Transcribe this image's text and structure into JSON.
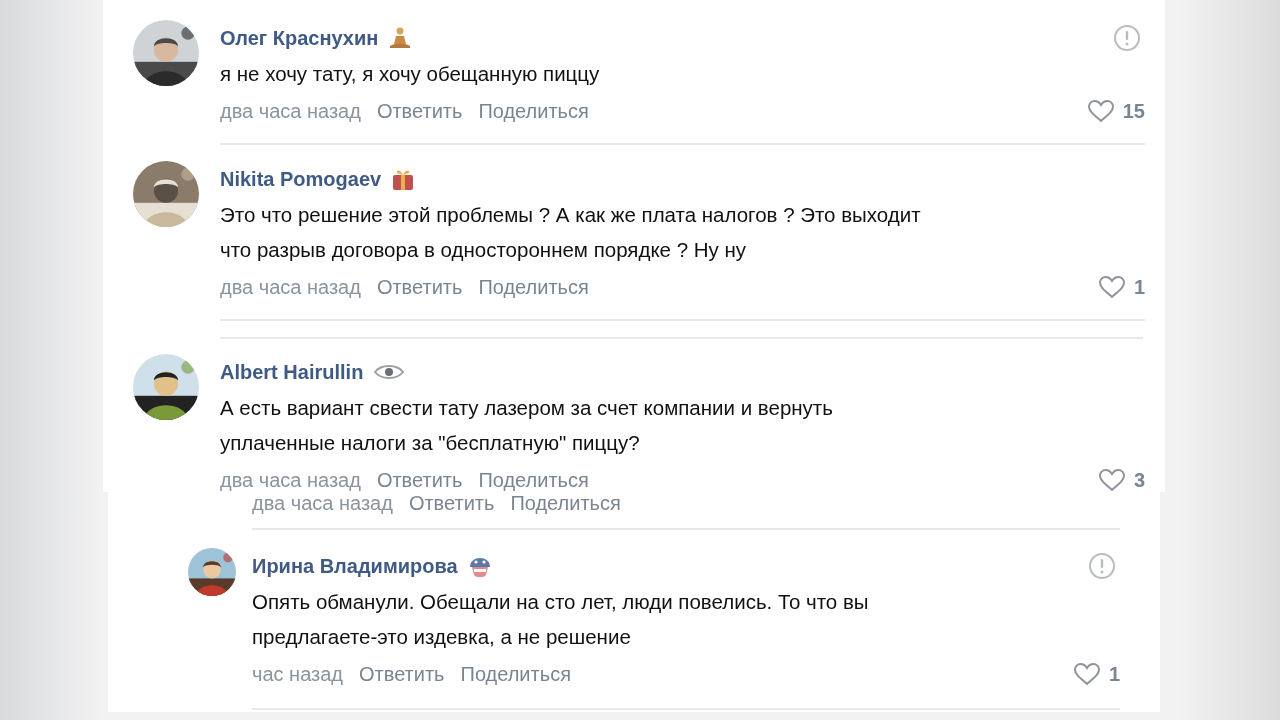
{
  "threads": [
    {
      "comments": [
        {
          "author": "Олег Краснухин",
          "badge": {
            "kind": "meditation"
          },
          "report_icon": true,
          "text": [
            "я не хочу тату, я хочу обещанную пиццу"
          ],
          "time": "два часа назад",
          "reply": "Ответить",
          "share": "Поделиться",
          "likes": "15",
          "avatar": {
            "kind": "picture"
          }
        },
        {
          "author": "Nikita Pomogaev",
          "badge": {
            "kind": "gift"
          },
          "report_icon": false,
          "text": [
            "Это что решение этой проблемы ? А как же плата налогов ? Это выходит",
            "что разрыв договора в одностороннем порядке ? Ну ну"
          ],
          "time": "два часа назад",
          "reply": "Ответить",
          "share": "Поделиться",
          "likes": "1",
          "avatar": {
            "kind": "picture"
          }
        },
        {
          "author": "Albert Hairullin",
          "badge": {
            "kind": "eye"
          },
          "report_icon": false,
          "text": [
            "А есть вариант свести тату лазером за счет компании и вернуть",
            "уплаченные налоги за \"бесплатную\" пиццу?"
          ],
          "time": "два часа назад",
          "reply": "Ответить",
          "share": "Поделиться",
          "likes": "3",
          "avatar": {
            "kind": "picture"
          }
        }
      ]
    },
    {
      "cut_meta": {
        "time": "два часа назад",
        "reply": "Ответить",
        "share": "Поделиться"
      },
      "comments": [
        {
          "author": "Ирина Владимирова",
          "badge": {
            "kind": "helmet"
          },
          "report_icon": true,
          "text": [
            "Опять обманули. Обещали на сто лет, люди повелись. То что вы",
            "предлагаете-это издевка, а не решение"
          ],
          "time": "час назад",
          "reply": "Ответить",
          "share": "Поделиться",
          "likes": "1",
          "avatar": {
            "kind": "picture"
          }
        }
      ]
    }
  ]
}
